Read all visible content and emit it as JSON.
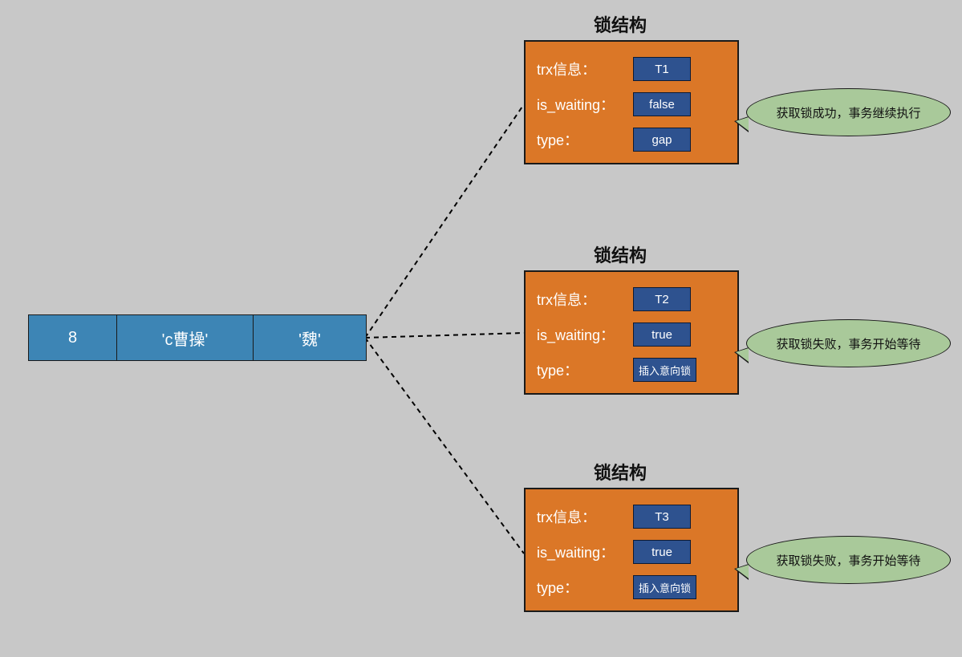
{
  "record": {
    "cells": [
      "8",
      "'c曹操'",
      "'魏'"
    ]
  },
  "lock_title": "锁结构",
  "field_labels": {
    "trx": "trx信息：",
    "is_waiting": "is_waiting：",
    "type": "type："
  },
  "locks": [
    {
      "trx": "T1",
      "is_waiting": "false",
      "type": "gap",
      "bubble": "获取锁成功，事务继续执行"
    },
    {
      "trx": "T2",
      "is_waiting": "true",
      "type": "插入意向锁",
      "bubble": "获取锁失败，事务开始等待"
    },
    {
      "trx": "T3",
      "is_waiting": "true",
      "type": "插入意向锁",
      "bubble": "获取锁失败，事务开始等待"
    }
  ]
}
